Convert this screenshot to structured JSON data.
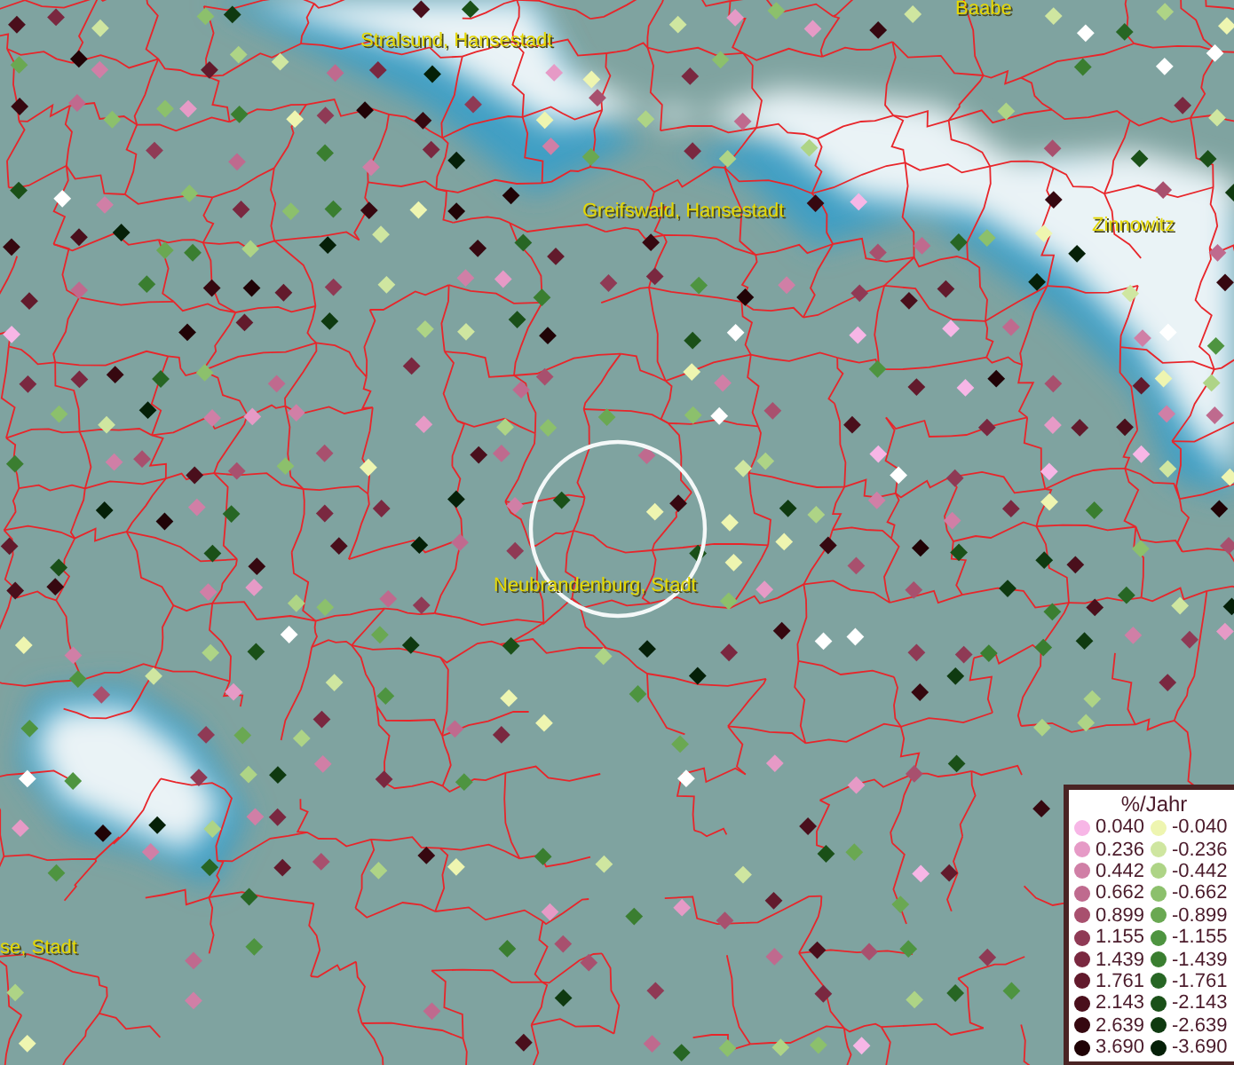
{
  "map": {
    "places": [
      {
        "name": "Baabe"
      },
      {
        "name": "Stralsund, Hansestadt"
      },
      {
        "name": "Greifswald, Hansestadt"
      },
      {
        "name": "Zinnowitz"
      },
      {
        "name": "Neubrandenburg, Stadt"
      },
      {
        "name": "se, Stadt"
      }
    ]
  },
  "legend": {
    "title": "%/Jahr",
    "items": [
      {
        "label": "0.040",
        "color": "#f7b6e6"
      },
      {
        "label": "0.236",
        "color": "#e69ac6"
      },
      {
        "label": "0.442",
        "color": "#d07fa6"
      },
      {
        "label": "0.662",
        "color": "#bf6a8e"
      },
      {
        "label": "0.899",
        "color": "#a8506e"
      },
      {
        "label": "1.155",
        "color": "#8f3a55"
      },
      {
        "label": "1.439",
        "color": "#7a2840"
      },
      {
        "label": "1.761",
        "color": "#621a2c"
      },
      {
        "label": "2.143",
        "color": "#4a0f1c"
      },
      {
        "label": "2.639",
        "color": "#360810"
      },
      {
        "label": "3.690",
        "color": "#200306"
      },
      {
        "label": "-0.040",
        "color": "#eef5b0"
      },
      {
        "label": "-0.236",
        "color": "#cfe6a0"
      },
      {
        "label": "-0.442",
        "color": "#aed486"
      },
      {
        "label": "-0.662",
        "color": "#8cc06c"
      },
      {
        "label": "-0.899",
        "color": "#6aa852"
      },
      {
        "label": "-1.155",
        "color": "#4e9440"
      },
      {
        "label": "-1.439",
        "color": "#3a7e30"
      },
      {
        "label": "-1.761",
        "color": "#276624"
      },
      {
        "label": "-2.143",
        "color": "#1a5018"
      },
      {
        "label": "-2.639",
        "color": "#0f3a10"
      },
      {
        "label": "-3.690",
        "color": "#052008"
      }
    ]
  }
}
